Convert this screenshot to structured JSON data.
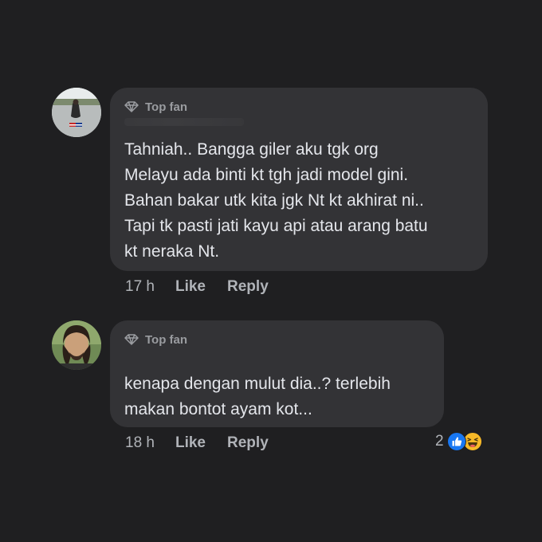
{
  "comments": [
    {
      "badge": "Top fan",
      "text": "Tahniah.. Bangga giler aku tgk org\nMelayu ada binti kt tgh jadi model gini.\nBahan bakar utk kita jgk Nt kt akhirat ni..\nTapi tk pasti jati kayu api atau arang batu\nkt neraka Nt.",
      "time": "17 h",
      "like_label": "Like",
      "reply_label": "Reply"
    },
    {
      "badge": "Top fan",
      "text": "kenapa dengan mulut dia..? terlebih\nmakan bontot ayam kot...",
      "time": "18 h",
      "like_label": "Like",
      "reply_label": "Reply",
      "reaction_count": "2",
      "reactions": [
        "like-reaction-icon",
        "haha-reaction-icon"
      ]
    }
  ],
  "colors": {
    "background": "#1f1f21",
    "bubble": "#333336",
    "text": "#e4e6eb",
    "meta": "#b0b3b8",
    "like_blue": "#1877f2",
    "haha_yellow": "#f7b928"
  }
}
